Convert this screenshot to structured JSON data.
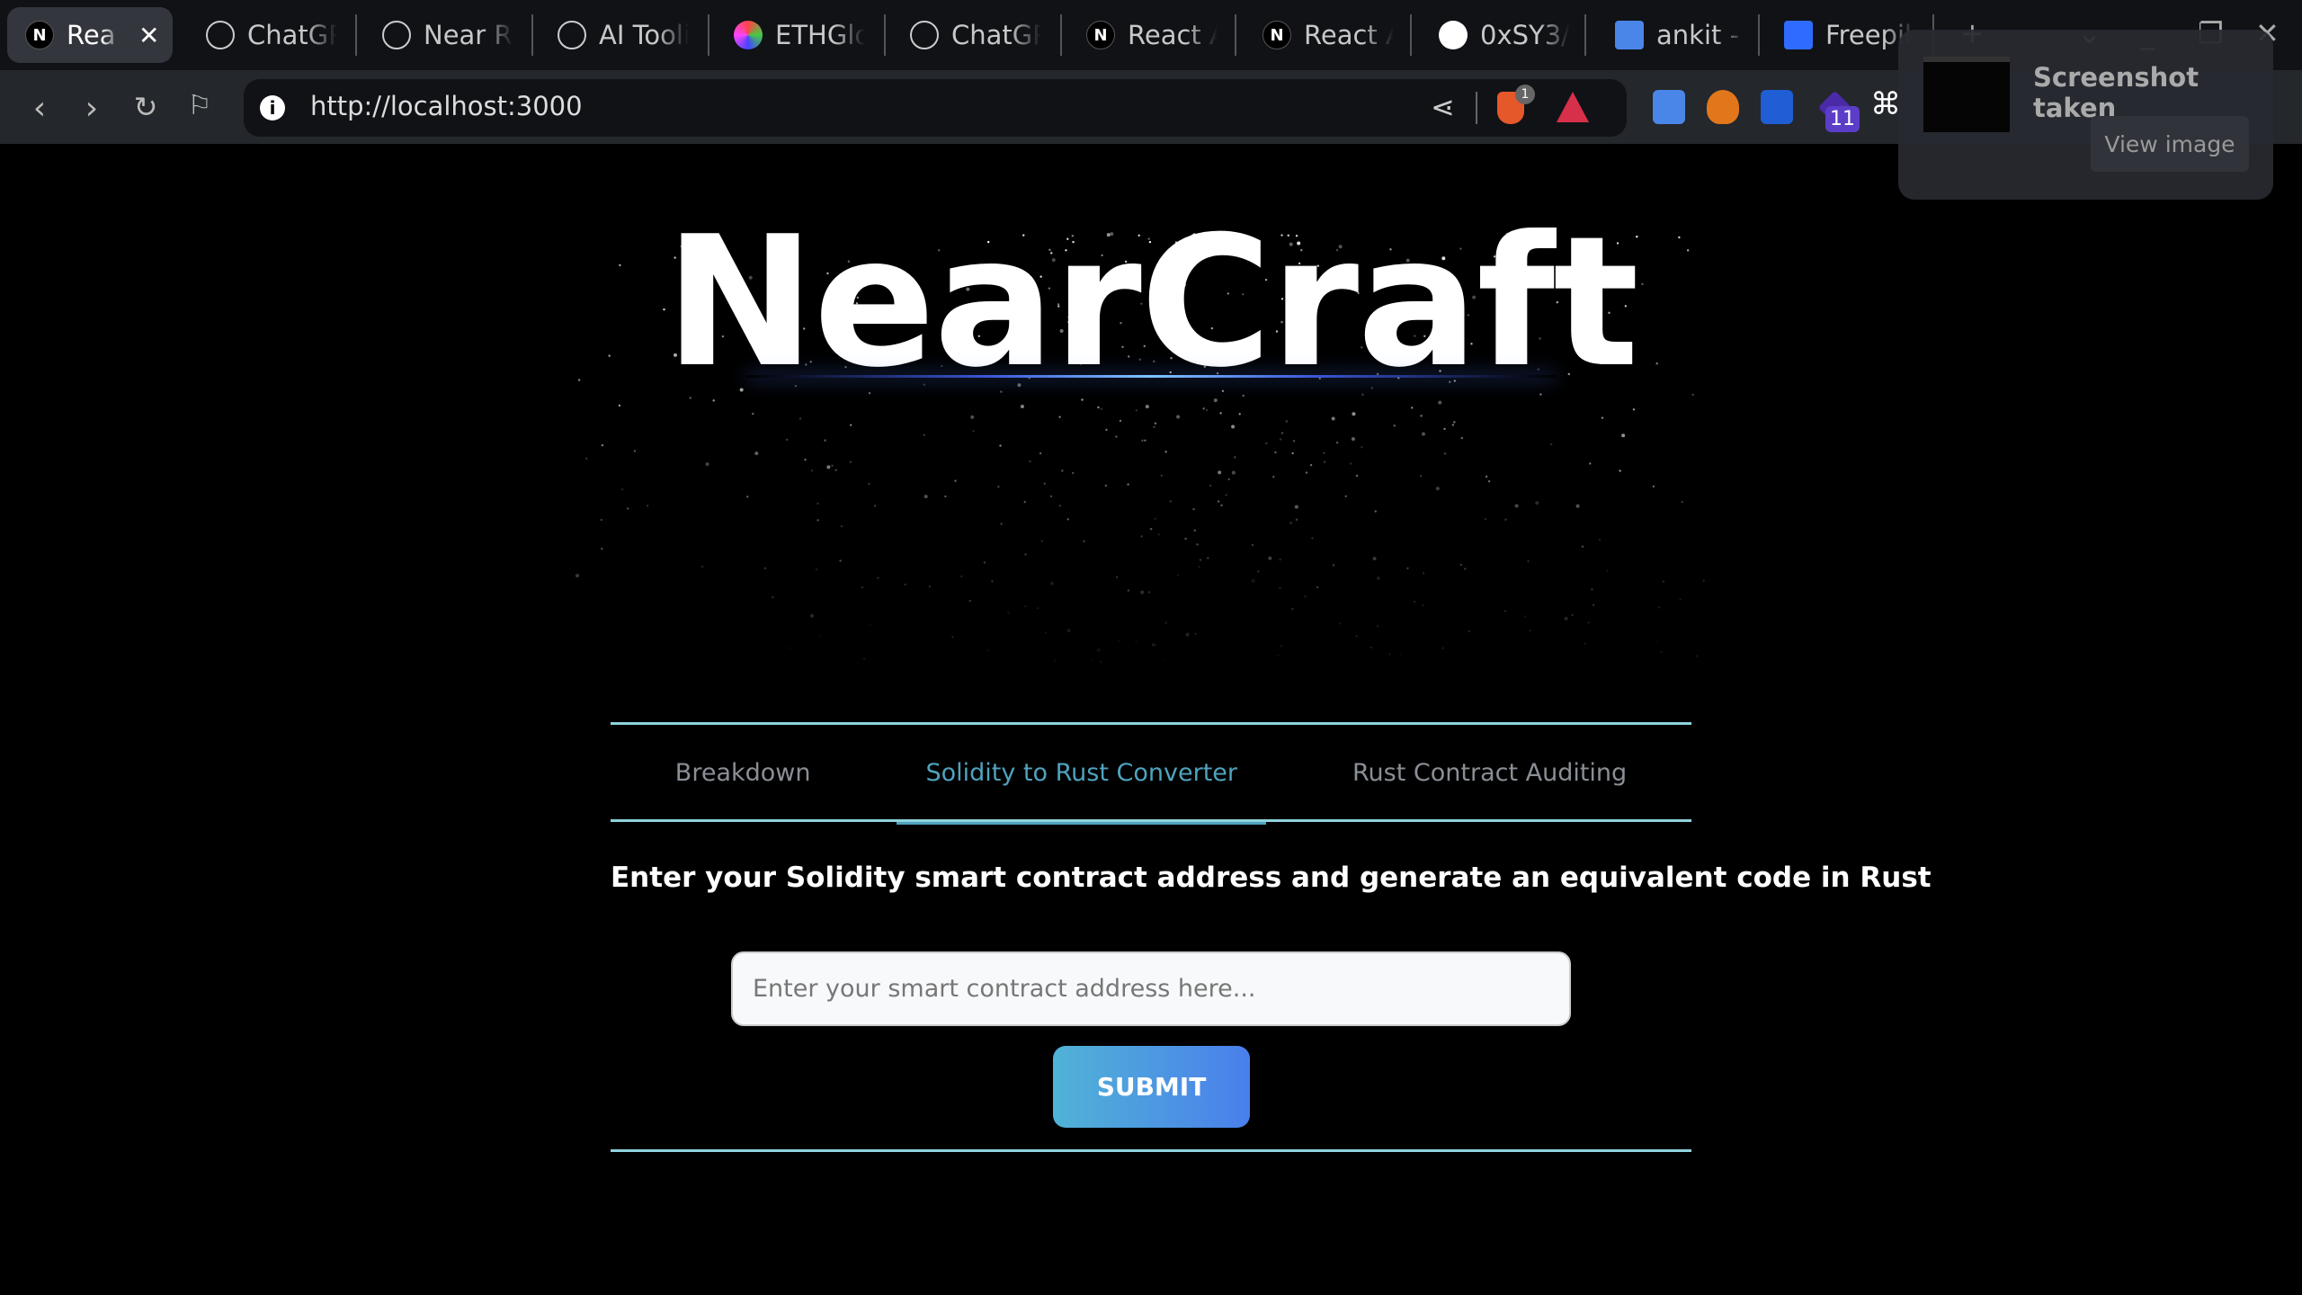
{
  "browser": {
    "tabs": [
      {
        "label": "Rea",
        "icon": "nextjs-icon",
        "active": true
      },
      {
        "label": "ChatGP",
        "icon": "openai-icon"
      },
      {
        "label": "Near Ru",
        "icon": "openai-icon"
      },
      {
        "label": "AI Tooli",
        "icon": "openai-icon"
      },
      {
        "label": "ETHGlo",
        "icon": "ethglobal-icon"
      },
      {
        "label": "ChatGP",
        "icon": "openai-icon"
      },
      {
        "label": "React A",
        "icon": "nextjs-icon"
      },
      {
        "label": "React A",
        "icon": "nextjs-icon"
      },
      {
        "label": "0xSY3/",
        "icon": "github-icon"
      },
      {
        "label": "ankit - (",
        "icon": "google-docs-icon"
      },
      {
        "label": "Freepik",
        "icon": "freepik-icon"
      }
    ],
    "url": "http://localhost:3000",
    "brave_badge": "1",
    "extension_badge": "11"
  },
  "notification": {
    "title": "Screenshot taken",
    "button": "View image"
  },
  "page": {
    "title": "NearCraft",
    "tabs": [
      "Breakdown",
      "Solidity to Rust Converter",
      "Rust Contract Auditing"
    ],
    "active_tab": 1,
    "heading": "Enter your Solidity smart contract address and generate an equivalent code in Rust",
    "input": {
      "placeholder": "Enter your smart contract address here...",
      "value": ""
    },
    "submit": "SUBMIT"
  },
  "colors": {
    "accent": "#4fa3be",
    "line": "#8fd3dc",
    "button_start": "#50b3d6",
    "button_end": "#4a7fec"
  }
}
